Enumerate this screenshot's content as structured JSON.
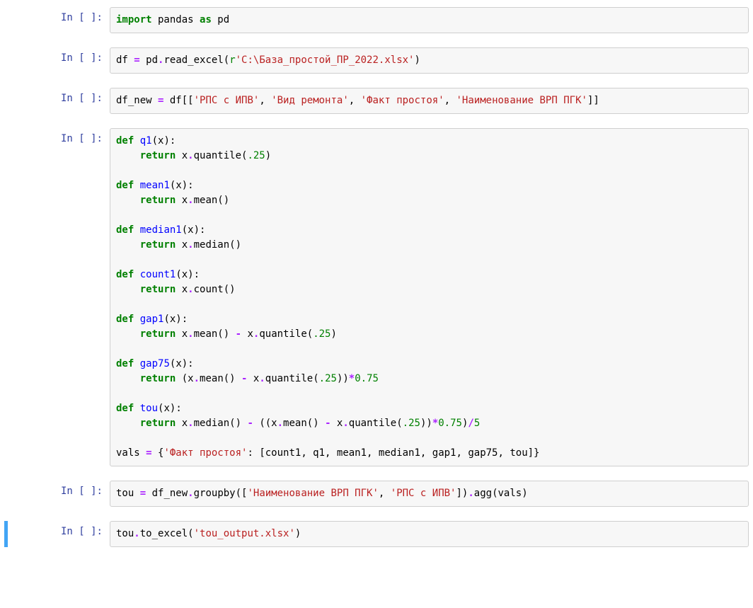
{
  "prompt": "In [ ]:",
  "cells": [
    {
      "tokens": [
        {
          "t": "import",
          "c": "kw"
        },
        {
          "t": " pandas ",
          "c": "nm"
        },
        {
          "t": "as",
          "c": "kw"
        },
        {
          "t": " pd",
          "c": "nm"
        }
      ]
    },
    {
      "tokens": [
        {
          "t": "df ",
          "c": "nm"
        },
        {
          "t": "=",
          "c": "op"
        },
        {
          "t": " pd",
          "c": "nm"
        },
        {
          "t": ".",
          "c": "op"
        },
        {
          "t": "read_excel(",
          "c": "nm"
        },
        {
          "t": "r",
          "c": "raw"
        },
        {
          "t": "'C:\\База_простой_ПР_2022.xlsx'",
          "c": "str"
        },
        {
          "t": ")",
          "c": "nm"
        }
      ]
    },
    {
      "tokens": [
        {
          "t": "df_new ",
          "c": "nm"
        },
        {
          "t": "=",
          "c": "op"
        },
        {
          "t": " df[[",
          "c": "nm"
        },
        {
          "t": "'РПС с ИПВ'",
          "c": "str"
        },
        {
          "t": ", ",
          "c": "nm"
        },
        {
          "t": "'Вид ремонта'",
          "c": "str"
        },
        {
          "t": ", ",
          "c": "nm"
        },
        {
          "t": "'Факт простоя'",
          "c": "str"
        },
        {
          "t": ", ",
          "c": "nm"
        },
        {
          "t": "'Наименование ВРП ПГК'",
          "c": "str"
        },
        {
          "t": "]]",
          "c": "nm"
        }
      ]
    },
    {
      "tokens": [
        {
          "t": "def",
          "c": "kw"
        },
        {
          "t": " ",
          "c": "nm"
        },
        {
          "t": "q1",
          "c": "fn"
        },
        {
          "t": "(x):",
          "c": "nm"
        },
        {
          "t": "\n    ",
          "c": "nm"
        },
        {
          "t": "return",
          "c": "kw"
        },
        {
          "t": " x",
          "c": "nm"
        },
        {
          "t": ".",
          "c": "op"
        },
        {
          "t": "quantile(",
          "c": "nm"
        },
        {
          "t": ".25",
          "c": "num"
        },
        {
          "t": ")",
          "c": "nm"
        },
        {
          "t": "\n\n",
          "c": "nm"
        },
        {
          "t": "def",
          "c": "kw"
        },
        {
          "t": " ",
          "c": "nm"
        },
        {
          "t": "mean1",
          "c": "fn"
        },
        {
          "t": "(x):",
          "c": "nm"
        },
        {
          "t": "\n    ",
          "c": "nm"
        },
        {
          "t": "return",
          "c": "kw"
        },
        {
          "t": " x",
          "c": "nm"
        },
        {
          "t": ".",
          "c": "op"
        },
        {
          "t": "mean()",
          "c": "nm"
        },
        {
          "t": "\n\n",
          "c": "nm"
        },
        {
          "t": "def",
          "c": "kw"
        },
        {
          "t": " ",
          "c": "nm"
        },
        {
          "t": "median1",
          "c": "fn"
        },
        {
          "t": "(x):",
          "c": "nm"
        },
        {
          "t": "\n    ",
          "c": "nm"
        },
        {
          "t": "return",
          "c": "kw"
        },
        {
          "t": " x",
          "c": "nm"
        },
        {
          "t": ".",
          "c": "op"
        },
        {
          "t": "median()",
          "c": "nm"
        },
        {
          "t": "\n\n",
          "c": "nm"
        },
        {
          "t": "def",
          "c": "kw"
        },
        {
          "t": " ",
          "c": "nm"
        },
        {
          "t": "count1",
          "c": "fn"
        },
        {
          "t": "(x):",
          "c": "nm"
        },
        {
          "t": "\n    ",
          "c": "nm"
        },
        {
          "t": "return",
          "c": "kw"
        },
        {
          "t": " x",
          "c": "nm"
        },
        {
          "t": ".",
          "c": "op"
        },
        {
          "t": "count()",
          "c": "nm"
        },
        {
          "t": "\n\n",
          "c": "nm"
        },
        {
          "t": "def",
          "c": "kw"
        },
        {
          "t": " ",
          "c": "nm"
        },
        {
          "t": "gap1",
          "c": "fn"
        },
        {
          "t": "(x):",
          "c": "nm"
        },
        {
          "t": "\n    ",
          "c": "nm"
        },
        {
          "t": "return",
          "c": "kw"
        },
        {
          "t": " x",
          "c": "nm"
        },
        {
          "t": ".",
          "c": "op"
        },
        {
          "t": "mean() ",
          "c": "nm"
        },
        {
          "t": "-",
          "c": "op"
        },
        {
          "t": " x",
          "c": "nm"
        },
        {
          "t": ".",
          "c": "op"
        },
        {
          "t": "quantile(",
          "c": "nm"
        },
        {
          "t": ".25",
          "c": "num"
        },
        {
          "t": ")",
          "c": "nm"
        },
        {
          "t": "\n\n",
          "c": "nm"
        },
        {
          "t": "def",
          "c": "kw"
        },
        {
          "t": " ",
          "c": "nm"
        },
        {
          "t": "gap75",
          "c": "fn"
        },
        {
          "t": "(x):",
          "c": "nm"
        },
        {
          "t": "\n    ",
          "c": "nm"
        },
        {
          "t": "return",
          "c": "kw"
        },
        {
          "t": " (x",
          "c": "nm"
        },
        {
          "t": ".",
          "c": "op"
        },
        {
          "t": "mean() ",
          "c": "nm"
        },
        {
          "t": "-",
          "c": "op"
        },
        {
          "t": " x",
          "c": "nm"
        },
        {
          "t": ".",
          "c": "op"
        },
        {
          "t": "quantile(",
          "c": "nm"
        },
        {
          "t": ".25",
          "c": "num"
        },
        {
          "t": "))",
          "c": "nm"
        },
        {
          "t": "*",
          "c": "op"
        },
        {
          "t": "0.75",
          "c": "num"
        },
        {
          "t": "\n\n",
          "c": "nm"
        },
        {
          "t": "def",
          "c": "kw"
        },
        {
          "t": " ",
          "c": "nm"
        },
        {
          "t": "tou",
          "c": "fn"
        },
        {
          "t": "(x):",
          "c": "nm"
        },
        {
          "t": "\n    ",
          "c": "nm"
        },
        {
          "t": "return",
          "c": "kw"
        },
        {
          "t": " x",
          "c": "nm"
        },
        {
          "t": ".",
          "c": "op"
        },
        {
          "t": "median() ",
          "c": "nm"
        },
        {
          "t": "-",
          "c": "op"
        },
        {
          "t": " ((x",
          "c": "nm"
        },
        {
          "t": ".",
          "c": "op"
        },
        {
          "t": "mean() ",
          "c": "nm"
        },
        {
          "t": "-",
          "c": "op"
        },
        {
          "t": " x",
          "c": "nm"
        },
        {
          "t": ".",
          "c": "op"
        },
        {
          "t": "quantile(",
          "c": "nm"
        },
        {
          "t": ".25",
          "c": "num"
        },
        {
          "t": "))",
          "c": "nm"
        },
        {
          "t": "*",
          "c": "op"
        },
        {
          "t": "0.75",
          "c": "num"
        },
        {
          "t": ")",
          "c": "nm"
        },
        {
          "t": "/",
          "c": "op"
        },
        {
          "t": "5",
          "c": "num"
        },
        {
          "t": "\n\n",
          "c": "nm"
        },
        {
          "t": "vals ",
          "c": "nm"
        },
        {
          "t": "=",
          "c": "op"
        },
        {
          "t": " {",
          "c": "nm"
        },
        {
          "t": "'Факт простоя'",
          "c": "str"
        },
        {
          "t": ": [count1, q1, mean1, median1, gap1, gap75, tou]}",
          "c": "nm"
        }
      ]
    },
    {
      "tokens": [
        {
          "t": "tou ",
          "c": "nm"
        },
        {
          "t": "=",
          "c": "op"
        },
        {
          "t": " df_new",
          "c": "nm"
        },
        {
          "t": ".",
          "c": "op"
        },
        {
          "t": "groupby([",
          "c": "nm"
        },
        {
          "t": "'Наименование ВРП ПГК'",
          "c": "str"
        },
        {
          "t": ", ",
          "c": "nm"
        },
        {
          "t": "'РПС с ИПВ'",
          "c": "str"
        },
        {
          "t": "])",
          "c": "nm"
        },
        {
          "t": ".",
          "c": "op"
        },
        {
          "t": "agg(vals)",
          "c": "nm"
        }
      ]
    },
    {
      "selected": true,
      "tokens": [
        {
          "t": "tou",
          "c": "nm"
        },
        {
          "t": ".",
          "c": "op"
        },
        {
          "t": "to_excel(",
          "c": "nm"
        },
        {
          "t": "'tou_output.xlsx'",
          "c": "str"
        },
        {
          "t": ")",
          "c": "nm"
        }
      ]
    }
  ]
}
